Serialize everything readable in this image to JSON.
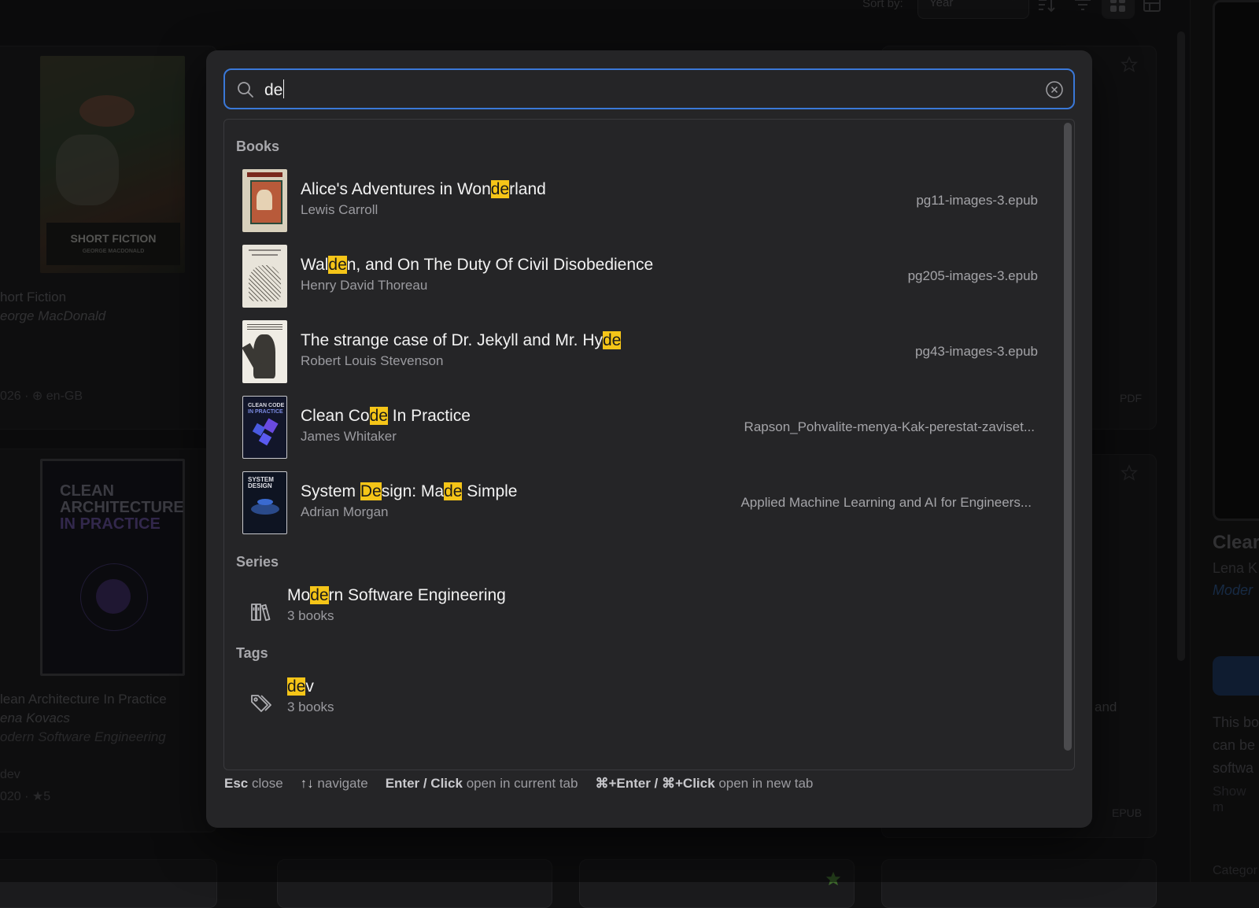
{
  "toolbar": {
    "sort_by_label": "Sort by:",
    "sort_value": "Year"
  },
  "background_cards": {
    "card1": {
      "cover_label": "SHORT FICTION",
      "cover_sub": "GEORGE MACDONALD",
      "title": "hort Fiction",
      "author": "eorge MacDonald",
      "meta": "026 · ⊕ en-GB"
    },
    "card2": {
      "cover_lines": [
        "CLEAN",
        "ARCHITECTURE",
        "IN PRACTICE"
      ],
      "title": "lean Architecture In Practice",
      "author": "ena Kovacs",
      "series": "odern Software Engineering",
      "tag": "dev",
      "meta": "020 · ★5"
    },
    "right_card_format_top": "PDF",
    "right_card_format_bottom": "EPUB",
    "right_card_title_tail": "and"
  },
  "side_panel": {
    "title": "Clear",
    "author": "Lena K",
    "series": "Moder",
    "desc_lines": [
      "This bo",
      "can be",
      "softwa"
    ],
    "show_more": "Show m",
    "category": "Categor"
  },
  "search": {
    "value": "de",
    "highlight_color": "#f5c518",
    "accent_color": "#3a78d8"
  },
  "sections": {
    "books": "Books",
    "series": "Series",
    "tags": "Tags"
  },
  "books": [
    {
      "title_pre": "Alice's Adventures in Won",
      "title_hl": "de",
      "title_post": "rland",
      "author": "Lewis Carroll",
      "file": "pg11-images-3.epub"
    },
    {
      "title_pre": "Wal",
      "title_hl": "de",
      "title_post": "n, and On The Duty Of Civil Disobedience",
      "author": "Henry David Thoreau",
      "file": "pg205-images-3.epub"
    },
    {
      "title_pre": "The strange case of Dr. Jekyll and Mr. Hy",
      "title_hl": "de",
      "title_post": "",
      "author": "Robert Louis Stevenson",
      "file": "pg43-images-3.epub"
    },
    {
      "title_pre": "Clean Co",
      "title_hl": "de",
      "title_post": " In Practice",
      "author": "James Whitaker",
      "file": "Rapson_Pohvalite-menya-Kak-perestat-zaviset..."
    },
    {
      "title_pre": "System ",
      "title_hl": "De",
      "title_mid": "sign: Ma",
      "title_hl2": "de",
      "title_post": " Simple",
      "author": "Adrian Morgan",
      "file": "Applied Machine Learning and AI for Engineers..."
    }
  ],
  "series_items": [
    {
      "title_pre": "Mo",
      "title_hl": "de",
      "title_post": "rn Software Engineering",
      "count": "3 books",
      "icon": "library-icon"
    }
  ],
  "tag_items": [
    {
      "title_pre": "",
      "title_hl": "de",
      "title_post": "v",
      "count": "3 books",
      "icon": "tag-icon"
    }
  ],
  "footer": {
    "esc_key": "Esc",
    "esc_text": "close",
    "nav_key": "↑↓",
    "nav_text": "navigate",
    "enter_key": "Enter / Click",
    "enter_text": "open in current tab",
    "cmd_key": "⌘+Enter / ⌘+Click",
    "cmd_text": "open in new tab"
  }
}
